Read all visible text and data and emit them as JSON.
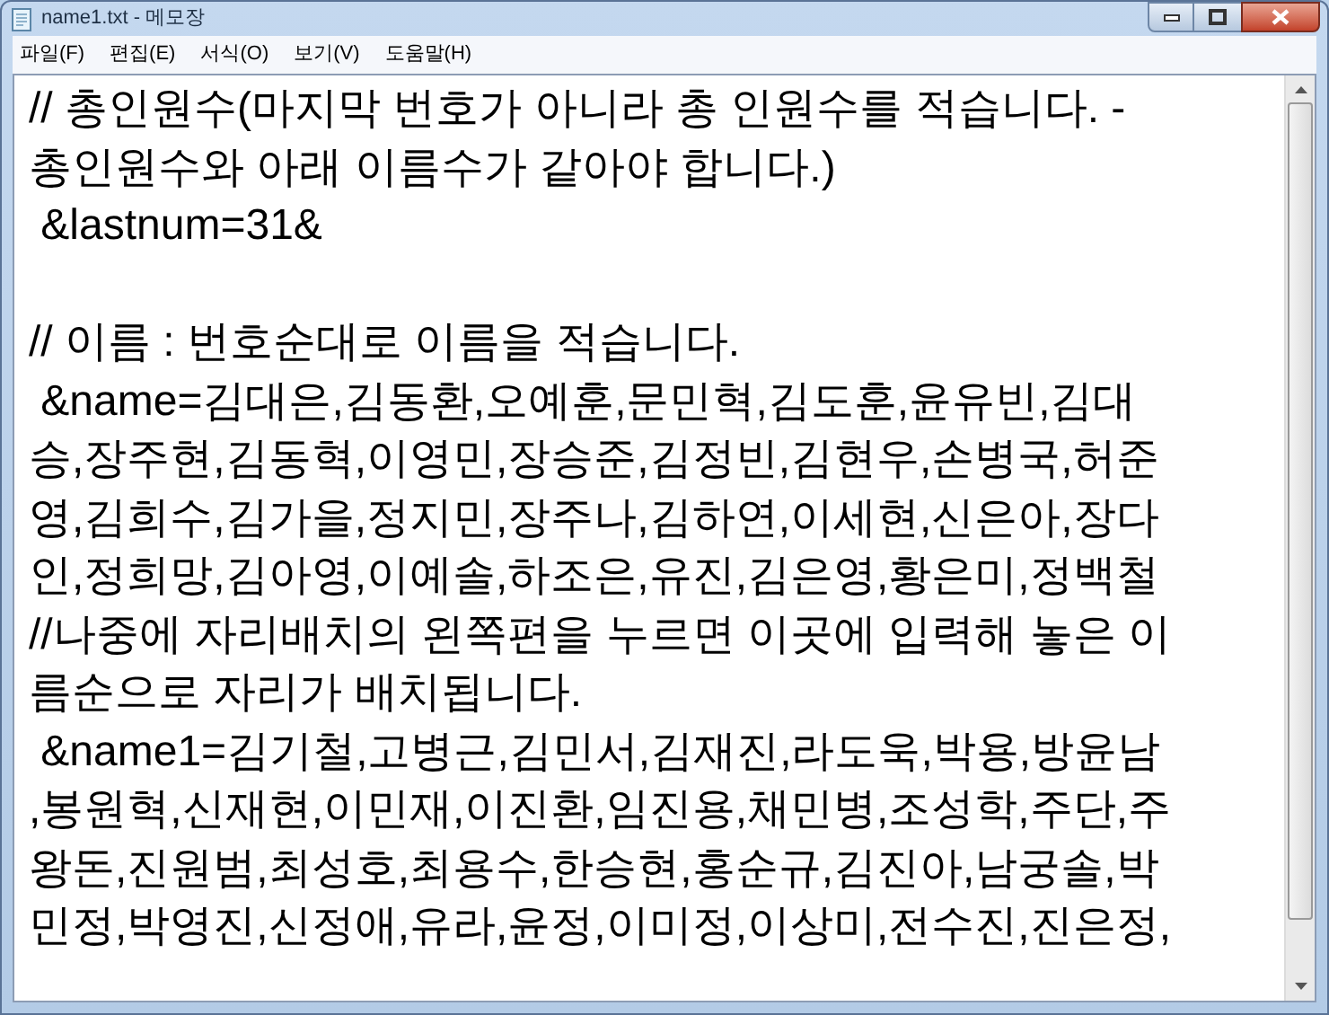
{
  "window": {
    "title": "name1.txt - 메모장"
  },
  "menu": [
    "파일(F)",
    "편집(E)",
    "서식(O)",
    "보기(V)",
    "도움말(H)"
  ],
  "lines": [
    {
      "kind": "text",
      "text": "// 총인원수(마지막 번호가 아니라 총 인원수를 적습니다. -"
    },
    {
      "kind": "text",
      "text": "총인원수와 아래 이름수가 같아야 합니다.)"
    },
    {
      "kind": "text",
      "text": " &lastnum=31&"
    },
    {
      "kind": "blank"
    },
    {
      "kind": "text",
      "text": "// 이름 : 번호순대로 이름을 적습니다."
    },
    {
      "kind": "text",
      "text": " &name=김대은,김동환,오예훈,문민혁,김도훈,윤유빈,김대"
    },
    {
      "kind": "text",
      "text": "승,장주현,김동혁,이영민,장승준,김정빈,김현우,손병국,허준"
    },
    {
      "kind": "text",
      "text": "영,김희수,김가을,정지민,장주나,김하연,이세현,신은아,장다"
    },
    {
      "kind": "text",
      "text": "인,정희망,김아영,이예솔,하조은,유진,김은영,황은미,정백철"
    },
    {
      "kind": "text",
      "text": "//나중에 자리배치의 왼쪽편을 누르면 이곳에 입력해 놓은 이"
    },
    {
      "kind": "text",
      "text": "름순으로 자리가 배치됩니다."
    },
    {
      "kind": "text",
      "text": " &name1=김기철,고병근,김민서,김재진,라도욱,박용,방윤남"
    },
    {
      "kind": "text",
      "text": ",봉원혁,신재현,이민재,이진환,임진용,채민병,조성학,주단,주"
    },
    {
      "kind": "text",
      "text": "왕돈,진원범,최성호,최용수,한승현,홍순규,김진아,남궁솔,박"
    },
    {
      "kind": "text",
      "text": "민정,박영진,신정애,유라,윤정,이미정,이상미,전수진,진은정,"
    }
  ]
}
